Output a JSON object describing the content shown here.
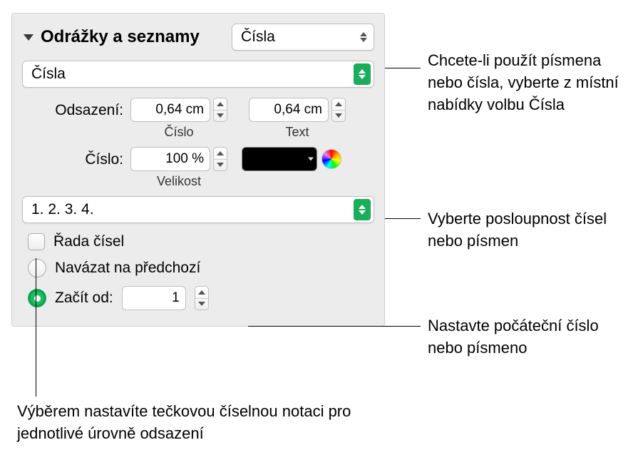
{
  "header": {
    "title": "Odrážky a seznamy",
    "style_select": "Čísla"
  },
  "type_select": "Čísla",
  "indent": {
    "label": "Odsazení:",
    "number": {
      "value": "0,64 cm",
      "sub": "Číslo"
    },
    "text": {
      "value": "0,64 cm",
      "sub": "Text"
    }
  },
  "number_size": {
    "label": "Číslo:",
    "value": "100 %",
    "sub": "Velikost"
  },
  "sequence_select": "1. 2. 3. 4.",
  "tiered_checkbox_label": "Řada čísel",
  "radio_continue": "Navázat na předchozí",
  "radio_start": "Začít od:",
  "start_value": "1",
  "callouts": {
    "c1": "Chcete-li použít písmena nebo čísla, vyberte z místní nabídky volbu Čísla",
    "c2": "Vyberte posloupnost čísel nebo písmen",
    "c3": "Nastavte počáteční číslo nebo písmeno",
    "c4": "Výběrem nastavíte tečkovou číselnou notaci pro jednotlivé úrovně odsazení"
  }
}
